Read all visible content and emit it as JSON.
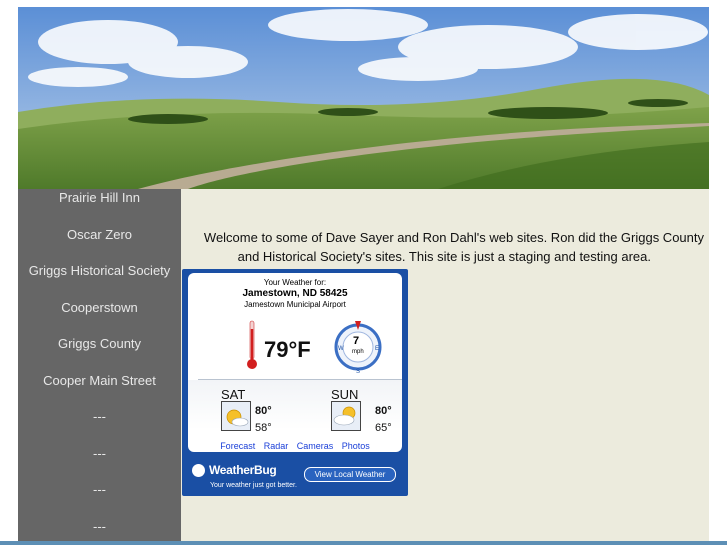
{
  "nav": {
    "items": [
      {
        "label": "Prairie Hill Inn"
      },
      {
        "label": "Oscar Zero"
      },
      {
        "label": "Griggs Historical Society"
      },
      {
        "label": "Cooperstown"
      },
      {
        "label": "Griggs County"
      },
      {
        "label": "Cooper Main Street"
      },
      {
        "label": "---"
      },
      {
        "label": "---"
      },
      {
        "label": "---"
      },
      {
        "label": "---"
      }
    ]
  },
  "main": {
    "welcome_line1": "Welcome to some of Dave Sayer and Ron Dahl's web sites. Ron did the Griggs County",
    "welcome_line2": "and Historical Society's sites. This site is just a staging and testing area."
  },
  "weather": {
    "header": "Your Weather for:",
    "city": "Jamestown, ND 58425",
    "station": "Jamestown Municipal Airport",
    "temperature": "79°F",
    "wind_speed": "7",
    "wind_unit": "mph",
    "forecast": [
      {
        "day": "SAT",
        "high": "80°",
        "low": "58°",
        "icon": "partly-sunny-icon"
      },
      {
        "day": "SUN",
        "high": "80°",
        "low": "65°",
        "icon": "partly-cloudy-icon"
      }
    ],
    "links": [
      "Forecast",
      "Radar",
      "Cameras",
      "Photos"
    ],
    "brand": "WeatherBug",
    "button": "View Local Weather",
    "tagline": "Your weather just got better."
  },
  "colors": {
    "sidebar": "#666666",
    "content_bg": "#ecebdd",
    "widget_blue": "#1a4fa4",
    "link_blue": "#1a3fd8"
  }
}
